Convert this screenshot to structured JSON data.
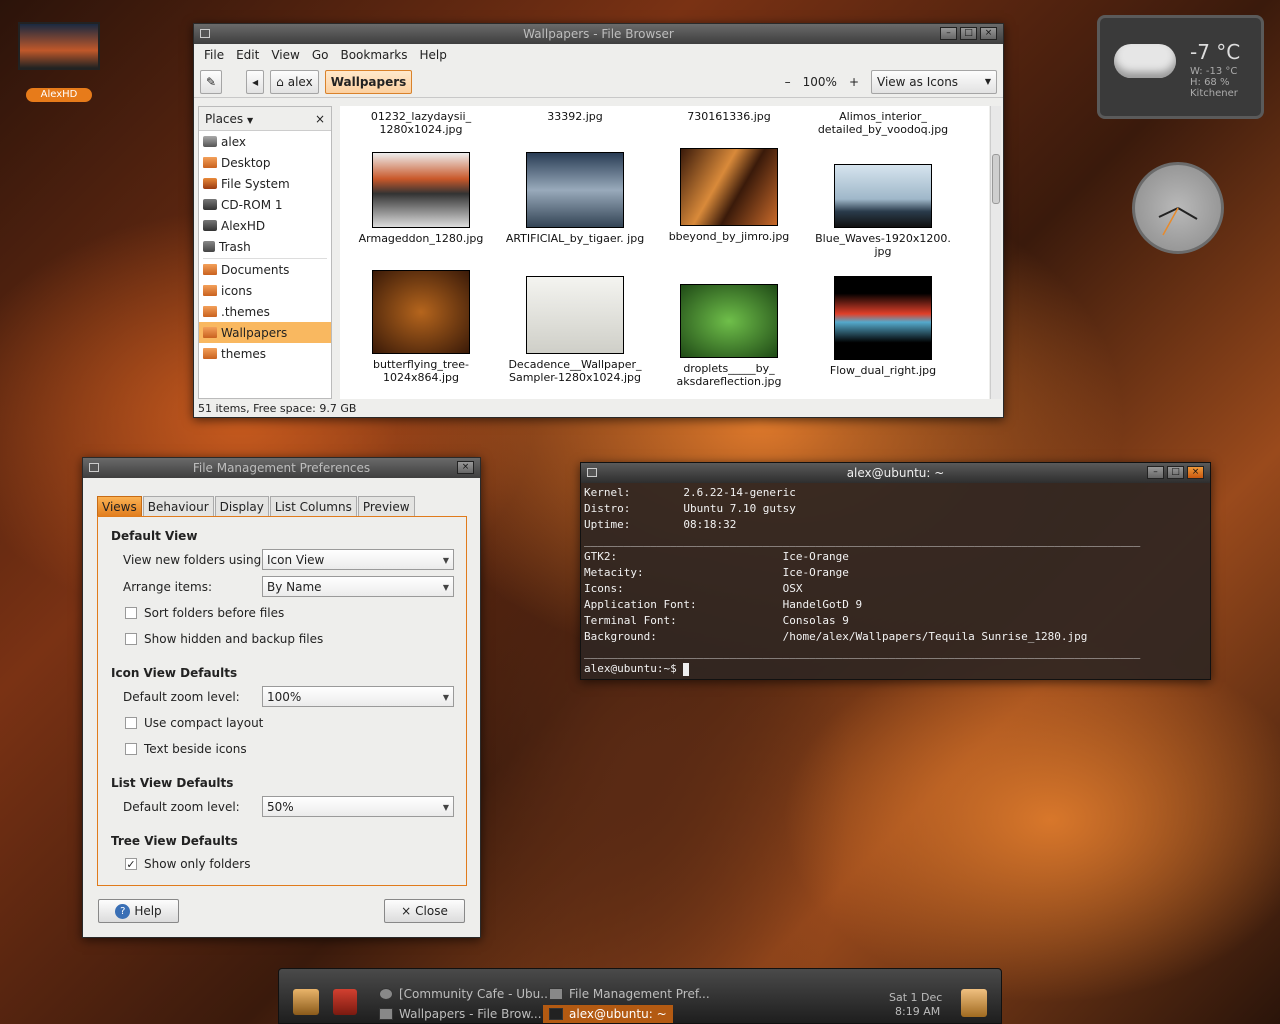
{
  "desktop": {
    "icon_label": "AlexHD"
  },
  "weather": {
    "temp": "-7 °C",
    "wind": "W: -13 °C",
    "humidity": "H: 68 %",
    "location": "Kitchener"
  },
  "browser": {
    "title": "Wallpapers - File Browser",
    "menu": [
      "File",
      "Edit",
      "View",
      "Go",
      "Bookmarks",
      "Help"
    ],
    "crumbs": [
      "alex",
      "Wallpapers"
    ],
    "zoom_out": "–",
    "zoom": "100%",
    "zoom_in": "+",
    "view_mode": "View as Icons",
    "places_header": "Places",
    "places": [
      "alex",
      "Desktop",
      "File System",
      "CD-ROM 1",
      "AlexHD",
      "Trash",
      "Documents",
      "icons",
      ".themes",
      "Wallpapers",
      "themes"
    ],
    "selected_place": "Wallpapers",
    "files_top": [
      "01232_lazydaysii_ 1280x1024.jpg",
      "33392.jpg",
      "730161336.jpg",
      "Alimos_interior_ detailed_by_voodoq.jpg"
    ],
    "files_row2": [
      "Armageddon_1280.jpg",
      "ARTIFICIAL_by_tigaer. jpg",
      "bbeyond_by_jimro.jpg",
      "Blue_Waves-1920x1200. jpg"
    ],
    "files_row3": [
      "butterflying_tree- 1024x864.jpg",
      "Decadence__Wallpaper_ Sampler-1280x1024.jpg",
      "droplets_____by_ aksdareflection.jpg",
      "Flow_dual_right.jpg"
    ],
    "status": "51 items, Free space: 9.7 GB"
  },
  "prefs": {
    "title": "File Management Preferences",
    "tabs": [
      "Views",
      "Behaviour",
      "Display",
      "List Columns",
      "Preview"
    ],
    "default_view_header": "Default View",
    "new_folders_label": "View new folders using:",
    "new_folders_value": "Icon View",
    "arrange_label": "Arrange items:",
    "arrange_value": "By Name",
    "sort_folders": "Sort folders before files",
    "show_hidden": "Show hidden and backup files",
    "icon_defaults_header": "Icon View Defaults",
    "icon_zoom_label": "Default zoom level:",
    "icon_zoom_value": "100%",
    "compact": "Use compact layout",
    "text_beside": "Text beside icons",
    "list_defaults_header": "List View Defaults",
    "list_zoom_label": "Default zoom level:",
    "list_zoom_value": "50%",
    "tree_defaults_header": "Tree View Defaults",
    "only_folders": "Show only folders",
    "help_button": "Help",
    "close_button": "Close"
  },
  "terminal": {
    "title": "alex@ubuntu: ~",
    "line1": "Kernel:        2.6.22-14-generic",
    "line2": "Distro:        Ubuntu 7.10 gutsy",
    "line3": "Uptime:        08:18:32",
    "sep": "____________________________________________________________________________________",
    "line4": "GTK2:                         Ice-Orange",
    "line5": "Metacity:                     Ice-Orange",
    "line6": "Icons:                        OSX",
    "line7": "Application Font:             HandelGotD 9",
    "line8": "Terminal Font:                Consolas 9",
    "line9": "Background:                   /home/alex/Wallpapers/Tequila Sunrise_1280.jpg",
    "prompt": "alex@ubuntu:~$ "
  },
  "panel": {
    "tasks": [
      "[Community Cafe - Ubu...",
      "File Management Pref...",
      "Wallpapers - File Brow...",
      "alex@ubuntu: ~"
    ],
    "date": "Sat 1 Dec",
    "time": "8:19 AM"
  }
}
